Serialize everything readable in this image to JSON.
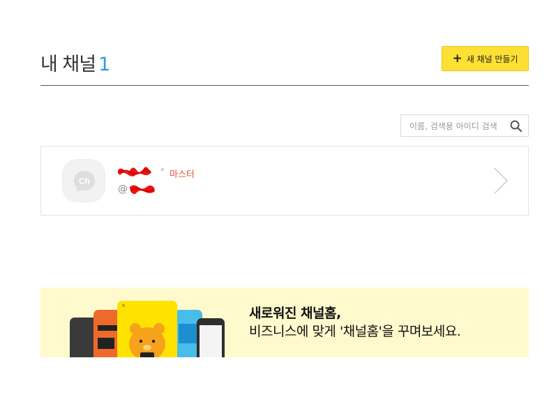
{
  "header": {
    "title": "내 채널",
    "count": "1",
    "create_button_label": "새 채널 만들기"
  },
  "search": {
    "placeholder": "이름, 검색용 아이디 검색",
    "value": ""
  },
  "channel": {
    "role": "마스터",
    "handle_prefix": "@",
    "avatar_label": "Ch"
  },
  "banner": {
    "title": "새로워진 채널홈,",
    "description": "비즈니스에 맞게 '채널홈'을 꾸며보세요."
  },
  "colors": {
    "accent_yellow": "#fde034",
    "count_blue": "#2b9ed8",
    "role_red": "#e55039",
    "banner_bg": "#fffacd"
  }
}
